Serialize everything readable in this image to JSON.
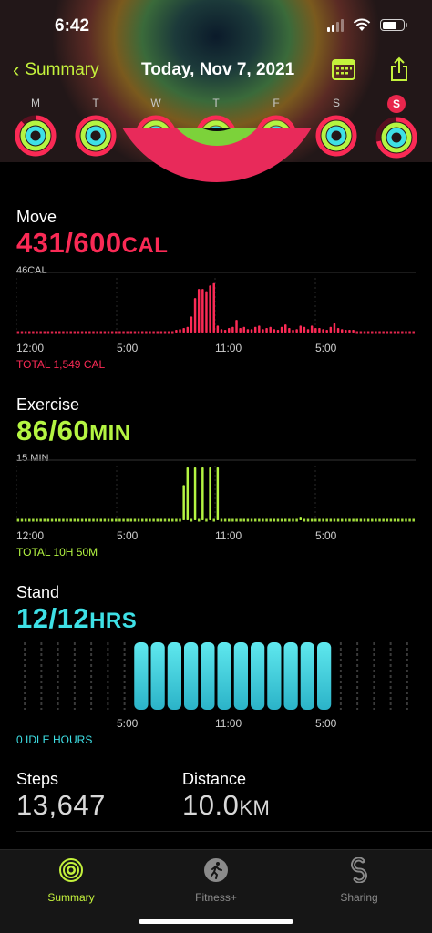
{
  "status_bar": {
    "time": "6:42"
  },
  "nav": {
    "back_label": "Summary",
    "title": "Today, Nov 7, 2021"
  },
  "week": {
    "days": [
      {
        "label": "M",
        "today": false
      },
      {
        "label": "T",
        "today": false
      },
      {
        "label": "W",
        "today": false
      },
      {
        "label": "T",
        "today": false
      },
      {
        "label": "F",
        "today": false
      },
      {
        "label": "S",
        "today": false
      },
      {
        "label": "S",
        "today": true
      }
    ]
  },
  "colors": {
    "move": "#fa2a55",
    "exercise": "#b4f542",
    "stand": "#3ee0e6",
    "accent": "#c4f23c"
  },
  "move": {
    "label": "Move",
    "value": "431/600",
    "unit": "CAL",
    "scale_label": "46CAL",
    "total": "TOTAL 1,549 CAL",
    "x_labels": [
      "12:00",
      "5:00",
      "11:00",
      "5:00"
    ]
  },
  "exercise": {
    "label": "Exercise",
    "value": "86/60",
    "unit": "MIN",
    "scale_label": "15 MIN",
    "total": "TOTAL 10H 50M",
    "x_labels": [
      "12:00",
      "5:00",
      "11:00",
      "5:00"
    ]
  },
  "stand": {
    "label": "Stand",
    "value": "12/12",
    "unit": "HRS",
    "idle": "0 IDLE HOURS",
    "x_labels": [
      "5:00",
      "11:00",
      "5:00"
    ]
  },
  "steps": {
    "label": "Steps",
    "value": "13,647"
  },
  "distance": {
    "label": "Distance",
    "value": "10.0",
    "unit": "KM"
  },
  "tabs": [
    {
      "label": "Summary",
      "icon": "activity-rings-icon",
      "active": true
    },
    {
      "label": "Fitness+",
      "icon": "runner-icon",
      "active": false
    },
    {
      "label": "Sharing",
      "icon": "sharing-icon",
      "active": false
    }
  ],
  "chart_data": [
    {
      "type": "bar",
      "title": "Move",
      "ylim": [
        0,
        46
      ],
      "x_ticks": [
        "12:00",
        "5:00",
        "11:00",
        "5:00"
      ],
      "series": [
        {
          "name": "Move",
          "values": [
            0,
            0,
            0,
            0,
            0,
            0,
            0,
            0,
            0,
            0,
            0,
            0,
            0,
            0,
            0,
            0,
            0,
            0,
            0,
            0,
            0,
            0,
            0,
            0,
            0,
            0,
            0,
            0,
            0,
            0,
            0,
            0,
            0,
            0,
            0,
            0,
            0,
            0,
            0,
            0,
            0,
            0,
            1,
            3,
            4,
            5,
            14,
            30,
            38,
            38,
            36,
            41,
            43,
            6,
            3,
            2,
            4,
            5,
            11,
            4,
            5,
            3,
            3,
            5,
            6,
            3,
            4,
            5,
            3,
            2,
            5,
            7,
            4,
            2,
            3,
            6,
            5,
            3,
            6,
            4,
            4,
            3,
            2,
            5,
            8,
            4,
            3,
            2,
            2,
            1,
            0,
            0,
            0,
            0,
            0,
            0,
            0,
            0,
            0,
            0,
            0,
            0,
            0,
            0,
            0,
            0
          ]
        }
      ]
    },
    {
      "type": "bar",
      "title": "Exercise",
      "ylim": [
        0,
        15
      ],
      "x_ticks": [
        "12:00",
        "5:00",
        "11:00",
        "5:00"
      ],
      "series": [
        {
          "name": "Exercise",
          "values": [
            0,
            0,
            0,
            0,
            0,
            0,
            0,
            0,
            0,
            0,
            0,
            0,
            0,
            0,
            0,
            0,
            0,
            0,
            0,
            0,
            0,
            0,
            0,
            0,
            0,
            0,
            0,
            0,
            0,
            0,
            0,
            0,
            0,
            0,
            0,
            0,
            0,
            0,
            0,
            0,
            0,
            0,
            0,
            0,
            10,
            15,
            0,
            15,
            0,
            15,
            0,
            15,
            0,
            15,
            0,
            0,
            0,
            0,
            0,
            0,
            0,
            0,
            0,
            0,
            0,
            0,
            0,
            0,
            0,
            0,
            0,
            0,
            0,
            0,
            0,
            1,
            0,
            0,
            0,
            0,
            0,
            0,
            0,
            0,
            0,
            0,
            0,
            0,
            0,
            0,
            0,
            0,
            0,
            0,
            0,
            0,
            0,
            0,
            0,
            0,
            0,
            0,
            0,
            0,
            0,
            0
          ]
        }
      ]
    },
    {
      "type": "bar",
      "title": "Stand",
      "x_ticks": [
        "5:00",
        "11:00",
        "5:00"
      ],
      "series": [
        {
          "name": "Stand",
          "values": [
            0,
            0,
            0,
            0,
            0,
            0,
            0,
            1,
            1,
            1,
            1,
            1,
            1,
            1,
            1,
            1,
            1,
            1,
            1,
            0,
            0,
            0,
            0,
            0
          ]
        }
      ]
    }
  ]
}
